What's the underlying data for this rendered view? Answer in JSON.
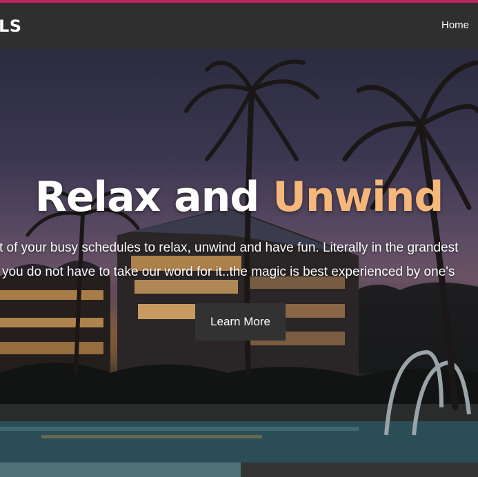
{
  "navbar": {
    "brand": "LS",
    "links": [
      {
        "label": "Home"
      }
    ]
  },
  "hero": {
    "title_part1": "Relax and ",
    "title_part2": "Unwind",
    "line1": "t of your busy schedules to relax, unwind and have fun. Literally in the grandest",
    "line2": "you do not have to take our word for it..the magic is best experienced by one's",
    "cta_label": "Learn More"
  },
  "colors": {
    "top_accent": "#c0245e",
    "navbar_bg": "#2f2f2f",
    "title_accent": "#f5b77a",
    "button_bg": "#323232"
  }
}
